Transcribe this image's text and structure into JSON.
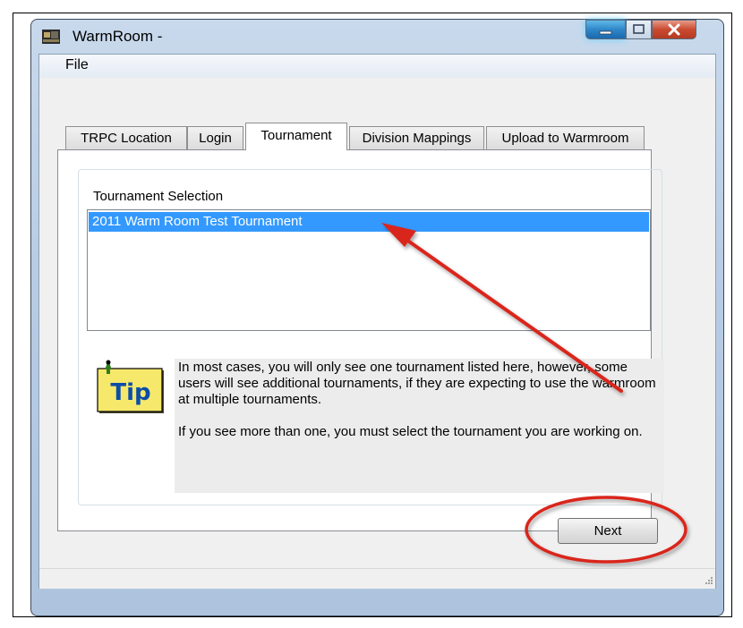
{
  "window": {
    "title": "WarmRoom -",
    "controls": [
      "minimize-icon",
      "maximize-icon",
      "close-icon"
    ]
  },
  "menu": {
    "file": "File"
  },
  "tabs": [
    {
      "label": "TRPC Location",
      "active": false
    },
    {
      "label": "Login",
      "active": false
    },
    {
      "label": "Tournament",
      "active": true
    },
    {
      "label": "Division Mappings",
      "active": false
    },
    {
      "label": "Upload to Warmroom",
      "active": false
    }
  ],
  "tournament": {
    "group_label": "Tournament Selection",
    "items": [
      "2011 Warm Room Test Tournament"
    ],
    "selected_index": 0
  },
  "tip": {
    "icon_label": "Tip",
    "paragraph1": "In most cases, you will only see one tournament listed here, however, some users will see additional tournaments, if they are expecting to use the warmroom at multiple tournaments.",
    "paragraph2": "If you see more than one, you must select the tournament you are working on."
  },
  "buttons": {
    "next": "Next"
  },
  "colors": {
    "selection": "#3399ff",
    "annotation": "#d9261c"
  }
}
